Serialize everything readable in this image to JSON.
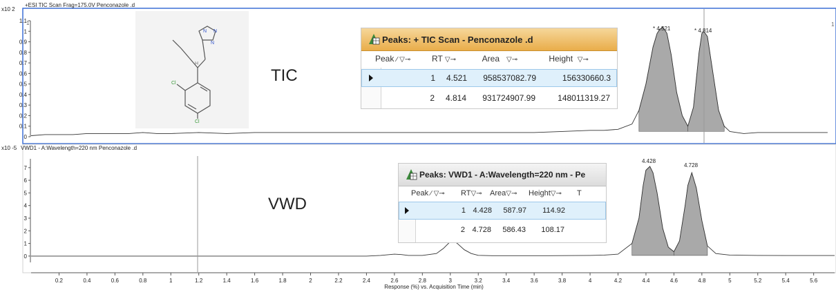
{
  "chart_data": [
    {
      "type": "line",
      "title": "+ESI TIC Scan Frag=175.0V Penconazole .d",
      "y_exponent_label": "x10 2",
      "ylim": [
        0,
        1.1
      ],
      "yticks": [
        "0",
        "0.1",
        "0.2",
        "0.3",
        "0.4",
        "0.5",
        "0.6",
        "0.7",
        "0.8",
        "0.9",
        "1",
        "1.1"
      ],
      "corner_label_left": "1",
      "corner_label_right": "1",
      "annotation": "TIC",
      "peak_labels": [
        "* 4.521",
        "* 4.814"
      ],
      "series": [
        {
          "x": [
            0.0,
            0.1,
            0.2,
            0.3,
            0.4,
            0.5,
            0.6,
            0.7,
            0.8,
            0.9,
            1.0,
            1.2,
            1.4,
            1.6,
            1.8,
            2.0,
            2.2,
            2.4,
            2.6,
            2.8,
            3.0,
            3.2,
            3.4,
            3.6,
            3.8,
            4.0,
            4.1,
            4.2,
            4.3,
            4.35,
            4.4,
            4.45,
            4.48,
            4.5,
            4.521,
            4.55,
            4.58,
            4.62,
            4.66,
            4.7,
            4.74,
            4.78,
            4.8,
            4.814,
            4.84,
            4.88,
            4.92,
            4.96,
            5.0,
            5.1,
            5.2,
            5.4,
            5.6,
            5.7
          ],
          "y": [
            0.01,
            0.02,
            0.02,
            0.02,
            0.03,
            0.03,
            0.03,
            0.03,
            0.04,
            0.03,
            0.03,
            0.04,
            0.03,
            0.04,
            0.04,
            0.04,
            0.04,
            0.04,
            0.04,
            0.04,
            0.04,
            0.04,
            0.04,
            0.04,
            0.05,
            0.06,
            0.06,
            0.07,
            0.12,
            0.25,
            0.5,
            0.85,
            0.98,
            1.02,
            1.04,
            0.98,
            0.78,
            0.42,
            0.2,
            0.1,
            0.28,
            0.8,
            0.98,
            1.0,
            0.95,
            0.6,
            0.25,
            0.1,
            0.05,
            0.03,
            0.04,
            0.04,
            0.04,
            0.04
          ]
        }
      ],
      "peaks_table": {
        "title": "Peaks: + TIC Scan - Penconazole .d",
        "columns": [
          "Peak",
          "RT",
          "Area",
          "Height"
        ],
        "rows": [
          [
            "1",
            "4.521",
            "958537082.79",
            "156330660.3"
          ],
          [
            "2",
            "4.814",
            "931724907.99",
            "148011319.27"
          ]
        ]
      }
    },
    {
      "type": "line",
      "title": "VWD1 - A:Wavelength=220 nm Penconazole .d",
      "y_exponent_label": "x10 -5",
      "ylim": [
        -0.5,
        7.7
      ],
      "yticks": [
        "0",
        "1",
        "2",
        "3",
        "4",
        "5",
        "6",
        "7"
      ],
      "annotation": "VWD",
      "peak_labels": [
        "4.428",
        "4.728"
      ],
      "xlabel": "Response (%) vs. Acquisition Time (min)",
      "xticks": [
        "0.2",
        "0.4",
        "0.6",
        "0.8",
        "1",
        "1.2",
        "1.4",
        "1.6",
        "1.8",
        "2",
        "2.2",
        "2.4",
        "2.6",
        "2.8",
        "3",
        "3.2",
        "3.4",
        "3.6",
        "3.8",
        "4",
        "4.2",
        "4.4",
        "4.6",
        "4.8",
        "5",
        "5.2",
        "5.4",
        "5.6"
      ],
      "xlim": [
        0,
        5.75
      ],
      "series": [
        {
          "x": [
            0.0,
            0.2,
            0.4,
            0.6,
            0.8,
            1.0,
            1.2,
            1.4,
            1.6,
            1.8,
            2.0,
            2.2,
            2.4,
            2.5,
            2.6,
            2.65,
            2.7,
            2.8,
            2.9,
            2.95,
            3.0,
            3.02,
            3.05,
            3.1,
            3.15,
            3.2,
            3.3,
            3.5,
            3.7,
            3.9,
            4.0,
            4.1,
            4.2,
            4.3,
            4.35,
            4.38,
            4.4,
            4.428,
            4.45,
            4.48,
            4.52,
            4.56,
            4.6,
            4.64,
            4.68,
            4.7,
            4.728,
            4.76,
            4.8,
            4.84,
            4.9,
            5.0,
            5.2,
            5.4,
            5.6,
            5.75
          ],
          "y": [
            0.0,
            0.0,
            0.0,
            0.0,
            0.0,
            0.0,
            0.0,
            0.0,
            0.0,
            0.0,
            0.0,
            0.0,
            0.0,
            0.05,
            0.15,
            0.12,
            0.05,
            0.05,
            0.2,
            0.6,
            1.15,
            1.25,
            1.0,
            0.5,
            0.2,
            0.06,
            0.03,
            0.03,
            0.03,
            0.04,
            0.05,
            0.08,
            0.15,
            1.0,
            3.0,
            5.6,
            6.8,
            7.1,
            6.6,
            5.0,
            2.2,
            0.7,
            0.35,
            1.2,
            4.0,
            5.6,
            6.6,
            5.4,
            2.8,
            0.8,
            0.2,
            0.08,
            0.05,
            0.04,
            0.04,
            0.04
          ]
        }
      ],
      "peaks_table": {
        "title": "Peaks: VWD1 - A:Wavelength=220 nm - Pe",
        "columns": [
          "Peak",
          "RT",
          "Area",
          "Height",
          "T"
        ],
        "rows": [
          [
            "1",
            "4.428",
            "587.97",
            "114.92"
          ],
          [
            "2",
            "4.728",
            "586.43",
            "108.17"
          ]
        ]
      }
    }
  ],
  "structure_image": "penconazole-structure",
  "colors": {
    "panel_border": "#3b6fd6",
    "peak_fill": "#a9a9a9",
    "table_header": "#efbf6a"
  }
}
